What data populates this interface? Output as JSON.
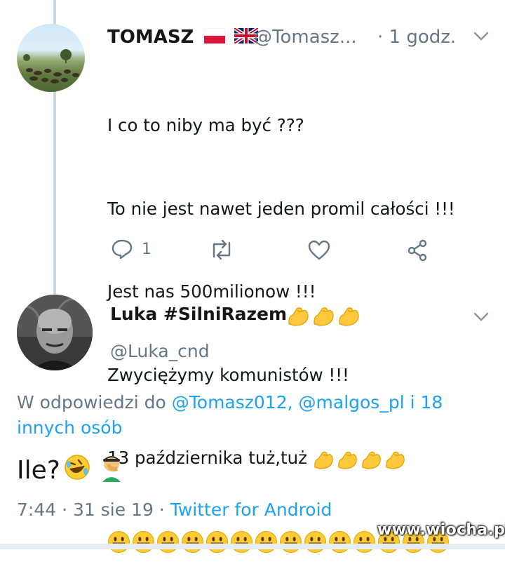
{
  "tweet1": {
    "name": "TOMASZ",
    "flags": [
      "polish-flag-icon",
      "uk-flag-icon"
    ],
    "handle": "@Tomasz...",
    "time": "· 1 godz.",
    "lines": [
      "I co to niby ma być ???",
      "To nie jest nawet jeden promil całości !!!",
      "Jest nas 500milionow !!!",
      "Zwyciężymy komunistów !!!",
      "13 października tuż,tuż"
    ],
    "muscle_emoji_count": 4,
    "grin_emoji_count": 14,
    "actions": {
      "reply_count": "1",
      "retweet_count": "",
      "like_count": ""
    }
  },
  "tweet2": {
    "name": "Luka #SilniRazem",
    "name_emoji_count": 3,
    "handle": "@Luka_cnd",
    "reply_prefix": "W odpowiedzi do ",
    "reply_mentions": "@Tomasz012, @malgos_pl i 18 innych osób",
    "text": "Ile?",
    "time": "7:44",
    "date": "31 sie 19",
    "source": "Twitter for Android"
  },
  "watermark": "www.wiocha.pl",
  "colors": {
    "text": "#14171a",
    "secondary": "#657786",
    "link": "#1da1f2",
    "line": "#ccd6dd"
  }
}
